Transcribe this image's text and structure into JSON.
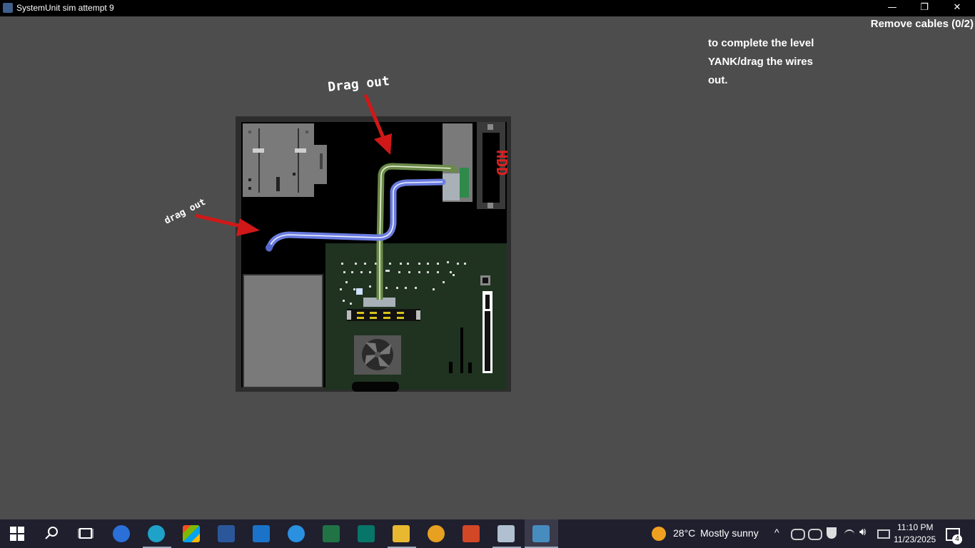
{
  "window": {
    "title": "SystemUnit sim attempt 9"
  },
  "window_controls": {
    "minimize": "—",
    "restore": "❐",
    "close": "✕"
  },
  "hud": {
    "objective": "Remove cables (0/2)",
    "removed": 0,
    "total": 2
  },
  "instructions": {
    "line1": "to complete the level",
    "line2": "YANK/drag the wires",
    "line3": "out."
  },
  "labels": {
    "top_hint": "Drag out",
    "left_hint": "drag out",
    "drive_label": "HDD"
  },
  "colors": {
    "background": "#4d4d4d",
    "blue_cable": "#6b7de0",
    "green_cable": "#6a8a4a",
    "arrow": "#d01818",
    "motherboard": "#1f3320"
  },
  "taskbar": {
    "icons": [
      "windows-start-icon",
      "search-icon",
      "task-view-icon",
      "media-player-icon",
      "edge-icon",
      "store-icon",
      "word-icon",
      "mail-icon",
      "cortana-icon",
      "excel-icon",
      "publisher-icon",
      "file-explorer-icon",
      "vpn-icon",
      "powerpoint-icon",
      "remote-desktop-icon",
      "godot-icon"
    ],
    "weather": {
      "temp": "28°C",
      "desc": "Mostly sunny"
    },
    "clock": {
      "time": "11:10 PM",
      "date": "11/23/2025"
    },
    "notifications": "4"
  }
}
